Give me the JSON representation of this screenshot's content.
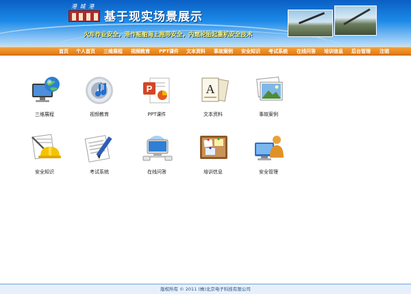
{
  "header": {
    "logo_text": "港 城 港",
    "title": "基于现实场景展示",
    "subtitle": "火车作业安全，港作船舶海上拖带安全，内燃轮胎起重机安全技术"
  },
  "nav": {
    "items": [
      "首页",
      "个人首页",
      "三维展程",
      "视频教育",
      "PPT课件",
      "文本资料",
      "事故案例",
      "安全知识",
      "考试系统",
      "在线问答",
      "培训信息",
      "后台管理",
      "注销"
    ]
  },
  "tiles": [
    {
      "label": "三维展程",
      "icon": "computer-globe-icon"
    },
    {
      "label": "视频教育",
      "icon": "music-disc-icon"
    },
    {
      "label": "PPT课件",
      "icon": "powerpoint-document-icon"
    },
    {
      "label": "文本资料",
      "icon": "font-book-icon"
    },
    {
      "label": "事故案例",
      "icon": "photo-stack-icon"
    },
    {
      "label": "安全知识",
      "icon": "hardhat-documents-icon"
    },
    {
      "label": "考试系统",
      "icon": "paper-pencil-icon"
    },
    {
      "label": "在线问答",
      "icon": "network-monitor-icon"
    },
    {
      "label": "培训信息",
      "icon": "corkboard-icon"
    },
    {
      "label": "安全管理",
      "icon": "user-monitor-icon"
    }
  ],
  "footer": {
    "text": "版权所有 © 2011  (株)北京电子科技有限公司"
  },
  "colors": {
    "header_blue": "#1c8ae8",
    "nav_orange": "#e07a12",
    "subtitle_yellow": "#fff36a"
  }
}
